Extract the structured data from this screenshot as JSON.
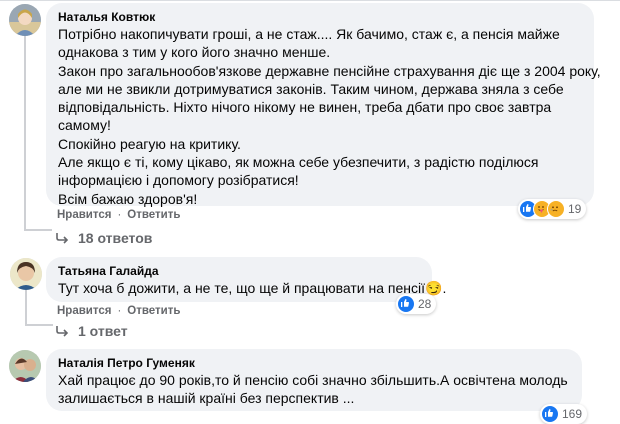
{
  "comments": [
    {
      "author": "Наталья Ковтюк",
      "lines": [
        "Потрібно накопичувати гроші, а не стаж.... Як бачимо, стаж є, а пенсія майже",
        "однакова з тим у кого його значно менше.",
        "Закон про загальнообов'язкове державне пенсійне страхування діє ще з 2004 року,",
        "але ми не звикли дотримуватися законів. Таким чином, держава зняла з себе",
        "відповідальність. Ніхто нічого нікому не винен, треба дбати про своє завтра",
        "самому!",
        "Спокійно реагую на критику.",
        "Але якщо є ті, кому цікаво, як можна себе убезпечити, з радістю поділюся",
        "інформацією і допомогу розібратися!",
        "Всім бажаю здоров'я!"
      ],
      "like": "Нравится",
      "reply": "Ответить",
      "reactions": [
        "like",
        "care",
        "sad"
      ],
      "reaction_count": "19",
      "replies_label": "18 ответов"
    },
    {
      "author": "Татьяна Галайда",
      "text_before": "Тут хоча б дожити, а не те, що ще й працювати на пенсії",
      "emoji": "😏",
      "text_after": ".",
      "like": "Нравится",
      "reply": "Ответить",
      "reactions": [
        "like"
      ],
      "reaction_count": "28",
      "replies_label": "1 ответ"
    },
    {
      "author": "Наталія Петро Гуменяк",
      "lines": [
        "Хай працює до 90 років,то й пенсію собі значно збільшить.А освічтена молодь",
        "залишається в нашій країні без перспектив ..."
      ],
      "reactions": [
        "like"
      ],
      "reaction_count": "169"
    }
  ],
  "colors": {
    "bubble": "#f0f2f5",
    "secondary_text": "#65676b",
    "like_blue": "#1877f2",
    "sad_yellow": "#f7b125"
  }
}
